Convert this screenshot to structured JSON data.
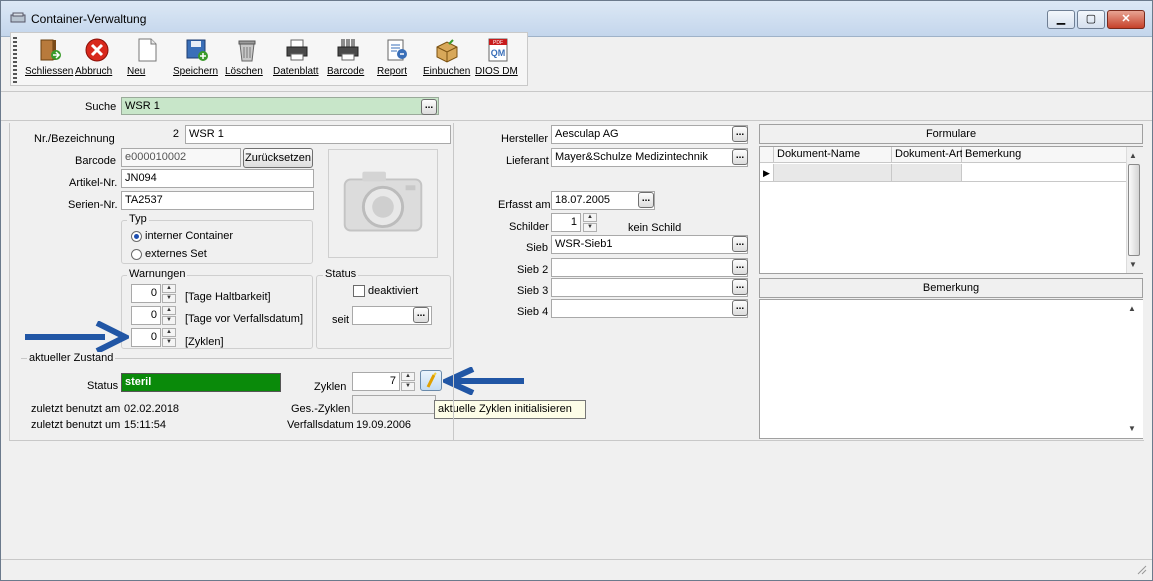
{
  "window": {
    "title": "Container-Verwaltung",
    "min": "▁",
    "max": "▢",
    "close": "✕"
  },
  "toolbar": [
    {
      "label": "Schliessen",
      "icon": "exit-door-icon"
    },
    {
      "label": "Abbruch",
      "icon": "cancel-icon"
    },
    {
      "label": "Neu",
      "icon": "new-document-icon"
    },
    {
      "label": "Speichern",
      "icon": "save-icon"
    },
    {
      "label": "Löschen",
      "icon": "trash-icon"
    },
    {
      "label": "Datenblatt",
      "icon": "printer-icon"
    },
    {
      "label": "Barcode",
      "icon": "barcode-printer-icon"
    },
    {
      "label": "Report",
      "icon": "report-icon"
    },
    {
      "label": "Einbuchen",
      "icon": "box-in-icon"
    },
    {
      "label": "DIOS DM",
      "icon": "dios-dm-icon"
    }
  ],
  "search": {
    "label": "Suche",
    "value": "WSR 1",
    "button": "..."
  },
  "left": {
    "nr_label": "Nr./Bezeichnung",
    "nr_value": "2",
    "bez_value": "WSR 1",
    "barcode_label": "Barcode",
    "barcode_value": "e000010002",
    "reset_button": "Zurücksetzen",
    "artikel_label": "Artikel-Nr.",
    "artikel_value": "JN094",
    "serien_label": "Serien-Nr.",
    "serien_value": "TA2537",
    "typ": {
      "title": "Typ",
      "opt1": "interner Container",
      "opt2": "externes Set"
    },
    "warnungen": {
      "title": "Warnungen",
      "rows": [
        {
          "value": "0",
          "label": "[Tage Haltbarkeit]"
        },
        {
          "value": "0",
          "label": "[Tage vor Verfallsdatum]"
        },
        {
          "value": "0",
          "label": "[Zyklen]"
        }
      ]
    },
    "status_group": {
      "title": "Status",
      "check_label": "deaktiviert",
      "seit_label": "seit",
      "seit_value": ""
    },
    "zustand": {
      "title": "aktueller Zustand",
      "status_label": "Status",
      "status_value": "steril",
      "zyklen_label": "Zyklen",
      "zyklen_value": "7",
      "benutzt_am_label": "zuletzt benutzt am",
      "benutzt_am_value": "02.02.2018",
      "ges_zyklen_label": "Ges.-Zyklen",
      "ges_zyklen_value": "",
      "benutzt_um_label": "zuletzt benutzt um",
      "benutzt_um_value": "15:11:54",
      "verfall_label": "Verfallsdatum",
      "verfall_value": "19.09.2006",
      "tooltip": "aktuelle Zyklen initialisieren"
    }
  },
  "middle": {
    "hersteller_label": "Hersteller",
    "hersteller_value": "Aesculap AG",
    "lieferant_label": "Lieferant",
    "lieferant_value": "Mayer&Schulze Medizintechnik",
    "erfasst_label": "Erfasst am",
    "erfasst_value": "18.07.2005",
    "schilder_label": "Schilder",
    "schilder_value": "1",
    "schilder_note": "kein Schild",
    "sieb_label": "Sieb",
    "sieb_value": "WSR-Sieb1",
    "sieb2_label": "Sieb 2",
    "sieb2_value": "",
    "sieb3_label": "Sieb 3",
    "sieb3_value": "",
    "sieb4_label": "Sieb 4",
    "sieb4_value": ""
  },
  "right": {
    "formulare_title": "Formulare",
    "columns": [
      "Dokument-Name",
      "Dokument-Art",
      "Bemerkung"
    ],
    "bemerkung_title": "Bemerkung"
  },
  "colors": {
    "accent_arrow": "#2156a5",
    "status_green": "#0a8a0a",
    "search_bg": "#c8e6c9"
  }
}
